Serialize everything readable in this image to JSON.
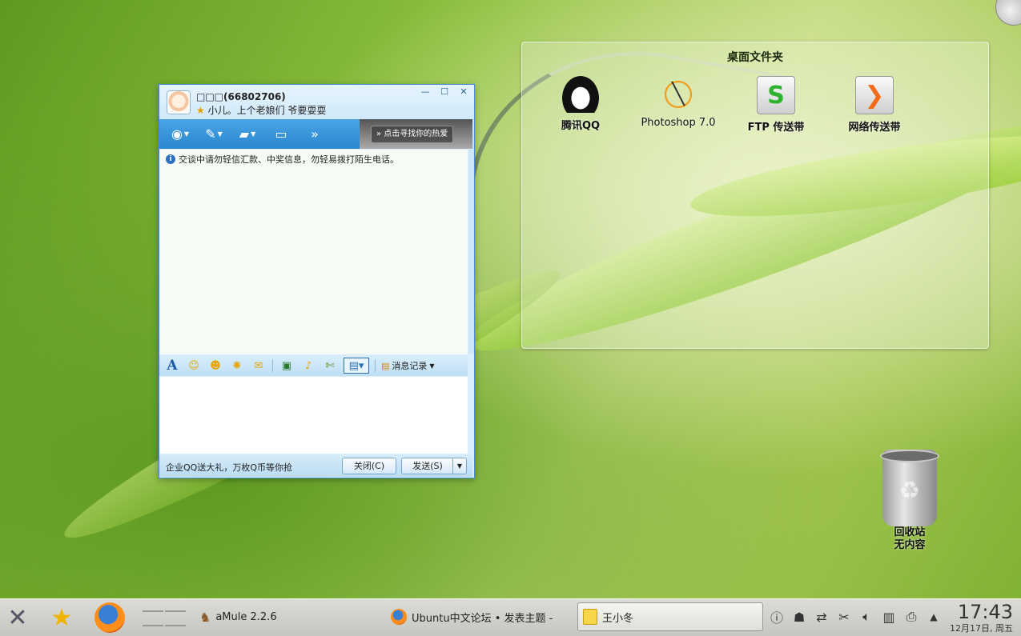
{
  "qq_chat": {
    "contact_name": "□□□(66802706)",
    "signature": "小儿。上个老娘们 爷要耍耍",
    "window_controls": {
      "minimize": "—",
      "maximize": "☐",
      "close": "✕"
    },
    "toolbar_icons": [
      "webcam-icon",
      "microphone-icon",
      "folder-transfer-icon",
      "remote-desktop-icon"
    ],
    "more_label": "»",
    "ad_button": "点击寻找你的热爱",
    "warning": "交谈中请勿轻信汇款、中奖信息，勿轻易拨打陌生电话。",
    "format_icons": [
      "font-icon",
      "emoticon-icon",
      "magic-face-icon",
      "shake-icon",
      "gift-icon",
      "image-icon",
      "music-icon",
      "screenshot-icon"
    ],
    "history_label": "消息记录",
    "footer_ad": "企业QQ送大礼，万枚Q币等你抢",
    "close_button": "关闭(C)",
    "send_button": "发送(S)"
  },
  "desktop_folder": {
    "title": "桌面文件夹",
    "items": [
      {
        "label": "腾讯QQ",
        "icon": "qq-penguin-icon"
      },
      {
        "label": "Photoshop 7.0",
        "icon": "photoshop-icon"
      },
      {
        "label": "FTP 传送带",
        "icon": "ftp-icon"
      },
      {
        "label": "网络传送带",
        "icon": "network-transfer-icon"
      }
    ]
  },
  "trash": {
    "label_line1": "回收站",
    "label_line2": "无内容"
  },
  "taskbar": {
    "tasks": [
      {
        "label": "aMule 2.2.6"
      },
      {
        "label": "Ubuntu中文论坛 • 发表主题 - "
      },
      {
        "label": "王小冬"
      }
    ],
    "tray_icons": [
      "info-icon",
      "qq-tray-icon",
      "network-icon",
      "scissors-icon",
      "volume-icon",
      "clipboard-icon",
      "printer-icon",
      "arrow-up-icon"
    ],
    "clock": {
      "time": "17:43",
      "date": "12月17日, 周五"
    }
  }
}
